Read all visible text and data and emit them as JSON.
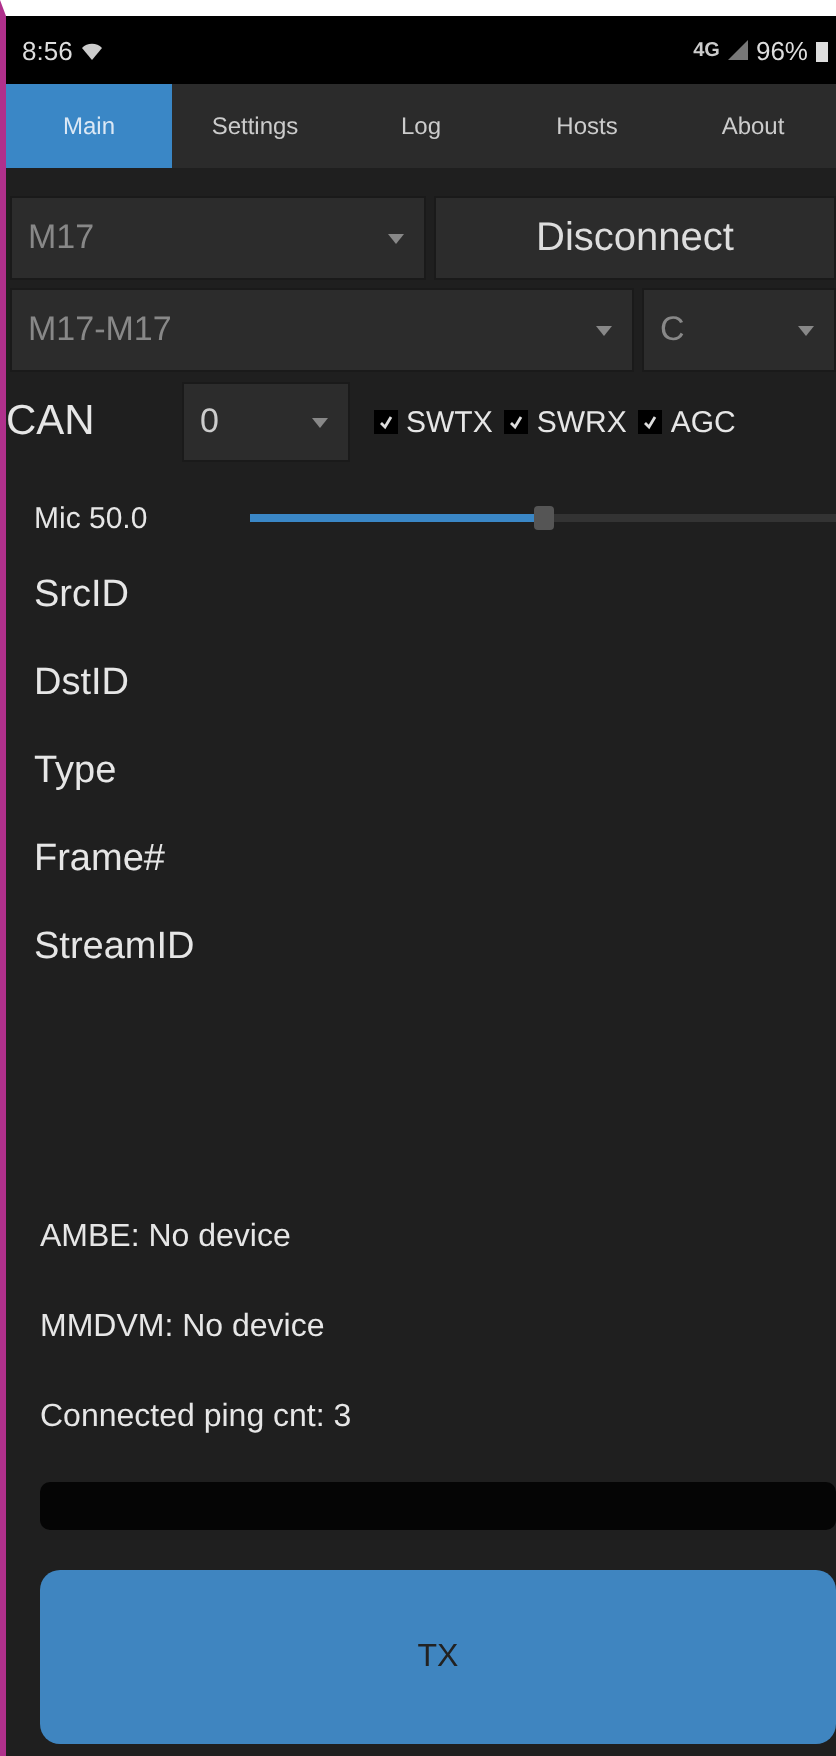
{
  "status_bar": {
    "time": "8:56",
    "network": "4G",
    "battery": "96%"
  },
  "tabs": [
    {
      "label": "Main",
      "selected": true
    },
    {
      "label": "Settings",
      "selected": false
    },
    {
      "label": "Log",
      "selected": false
    },
    {
      "label": "Hosts",
      "selected": false
    },
    {
      "label": "About",
      "selected": false
    }
  ],
  "mode_dropdown": {
    "value": "M17"
  },
  "connect_button": "Disconnect",
  "host_dropdown": {
    "value": "M17-M17"
  },
  "module_dropdown": {
    "value": "C"
  },
  "can": {
    "label": "CAN",
    "value": "0"
  },
  "checkboxes": [
    {
      "label": "SWTX",
      "checked": true
    },
    {
      "label": "SWRX",
      "checked": true
    },
    {
      "label": "AGC",
      "checked": true
    }
  ],
  "mic": {
    "label": "Mic 50.0",
    "level": 0.5
  },
  "fields": [
    "SrcID",
    "DstID",
    "Type",
    "Frame#",
    "StreamID"
  ],
  "status_lines": [
    "AMBE: No device",
    "MMDVM: No device",
    "Connected ping cnt: 3"
  ],
  "tx_button": "TX"
}
